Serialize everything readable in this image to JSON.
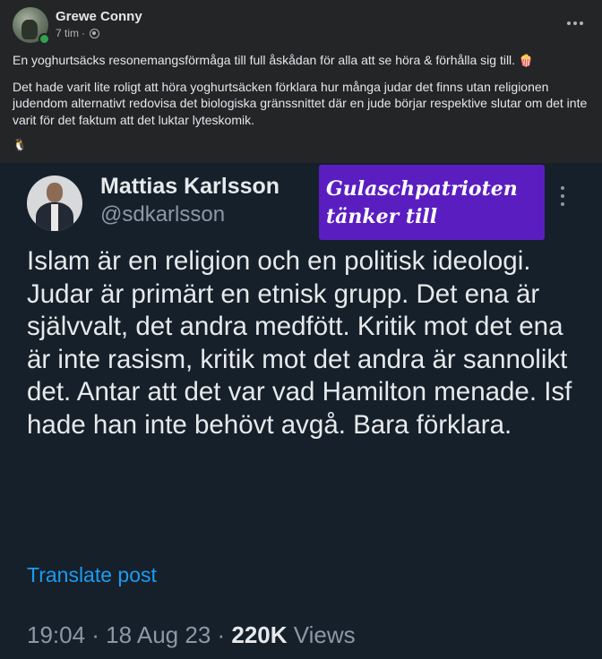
{
  "post": {
    "author": "Grewe Conny",
    "time": "7 tim",
    "separator": "·",
    "paragraph1": "En yoghurtsäcks resonemangsförmåga till full åskådan för alla att se höra & förhålla sig till.",
    "paragraph1_emoji": "🍿",
    "paragraph2": "Det hade varit lite roligt att höra yoghurtsäcken förklara hur många judar det finns utan religionen judendom alternativt redovisa det biologiska gränssnittet där en jude börjar respektive slutar om det inte varit för det faktum att det luktar lyteskomik.",
    "paragraph3_emoji": "🐧"
  },
  "tweet": {
    "name": "Mattias Karlsson",
    "handle": "@sdkarlsson",
    "badge_line1": "Gulaschpatrioten",
    "badge_line2": "tänker till",
    "text": "Islam är en religion och en politisk ideologi. Judar är primärt en etnisk grupp. Det ena är självvalt, det andra medfött. Kritik mot det ena är inte rasism, kritik mot det andra är sannolikt det. Antar att det var vad Hamilton menade. Isf hade han inte behövt avgå. Bara förklara.",
    "translate": "Translate post",
    "timestamp": "19:04 · 18 Aug 23 · ",
    "views_count": "220K",
    "views_label": " Views"
  },
  "colors": {
    "background": "#242526",
    "tweet_background": "#15202b",
    "badge": "#5a1ec0",
    "link": "#1d9bf0",
    "online": "#31a24c"
  },
  "icons": [
    "globe-icon",
    "more-options-icon",
    "online-status-icon"
  ]
}
